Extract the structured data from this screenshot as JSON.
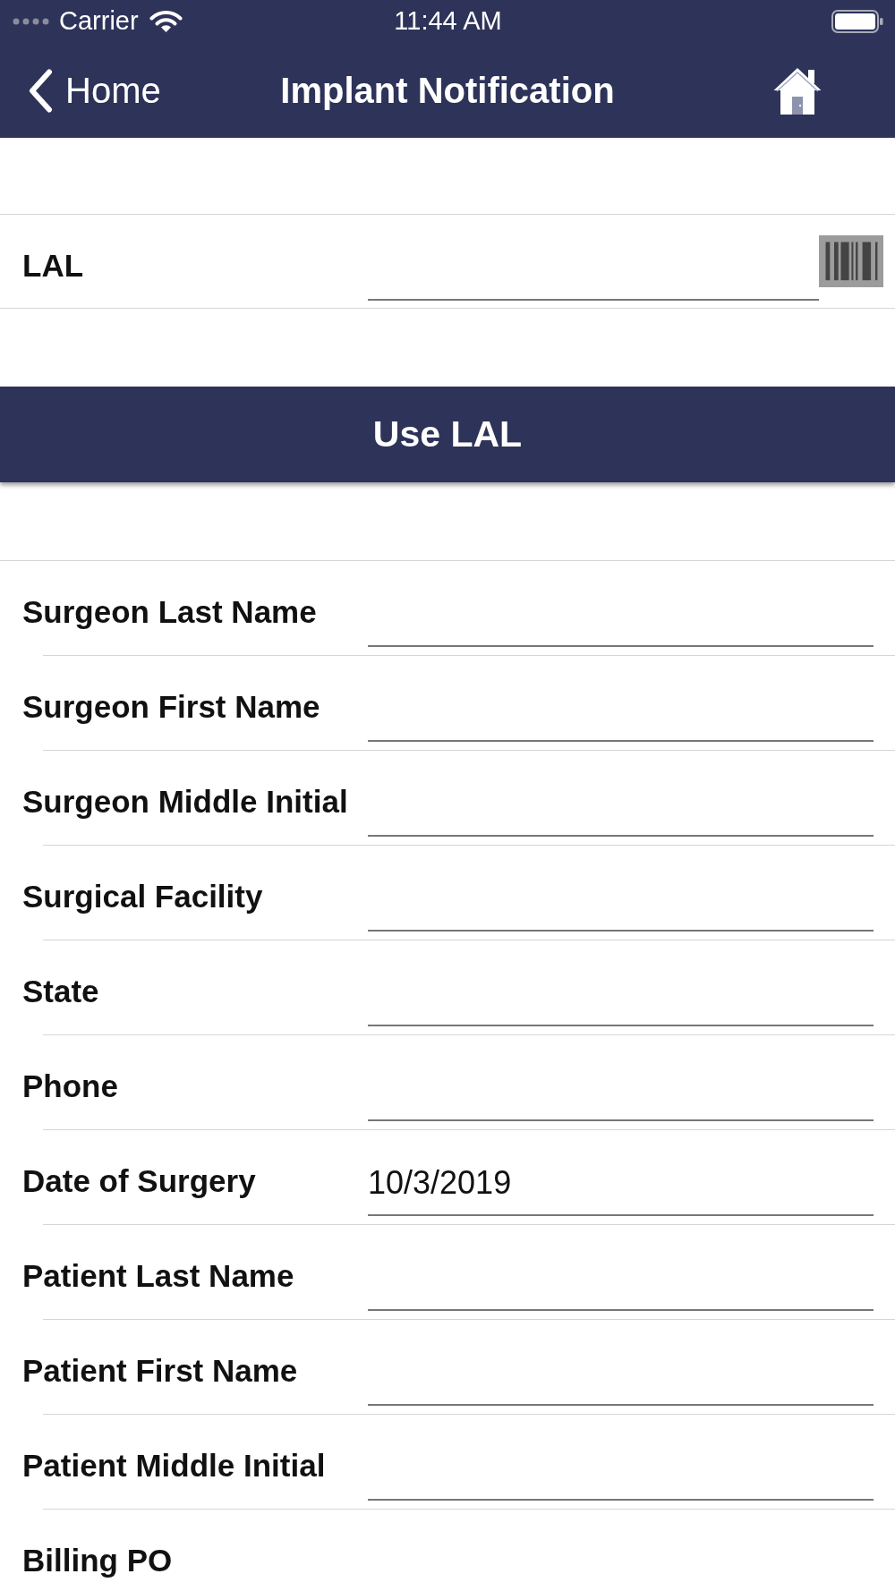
{
  "status_bar": {
    "carrier": "Carrier",
    "time": "11:44 AM"
  },
  "nav_bar": {
    "back_label": "Home",
    "title": "Implant Notification"
  },
  "lal": {
    "label": "LAL"
  },
  "use_button": {
    "label": "Use LAL"
  },
  "fields": [
    {
      "label": "Surgeon Last Name",
      "kind": "input"
    },
    {
      "label": "Surgeon First Name",
      "kind": "input"
    },
    {
      "label": "Surgeon Middle Initial",
      "kind": "input"
    },
    {
      "label": "Surgical Facility",
      "kind": "input"
    },
    {
      "label": "State",
      "kind": "input"
    },
    {
      "label": "Phone",
      "kind": "input"
    },
    {
      "label": "Date of Surgery",
      "kind": "input",
      "value": "10/3/2019"
    },
    {
      "label": "Patient Last Name",
      "kind": "input"
    },
    {
      "label": "Patient First Name",
      "kind": "input"
    },
    {
      "label": "Patient Middle Initial",
      "kind": "input"
    },
    {
      "label": "Billing PO",
      "kind": "label"
    }
  ]
}
